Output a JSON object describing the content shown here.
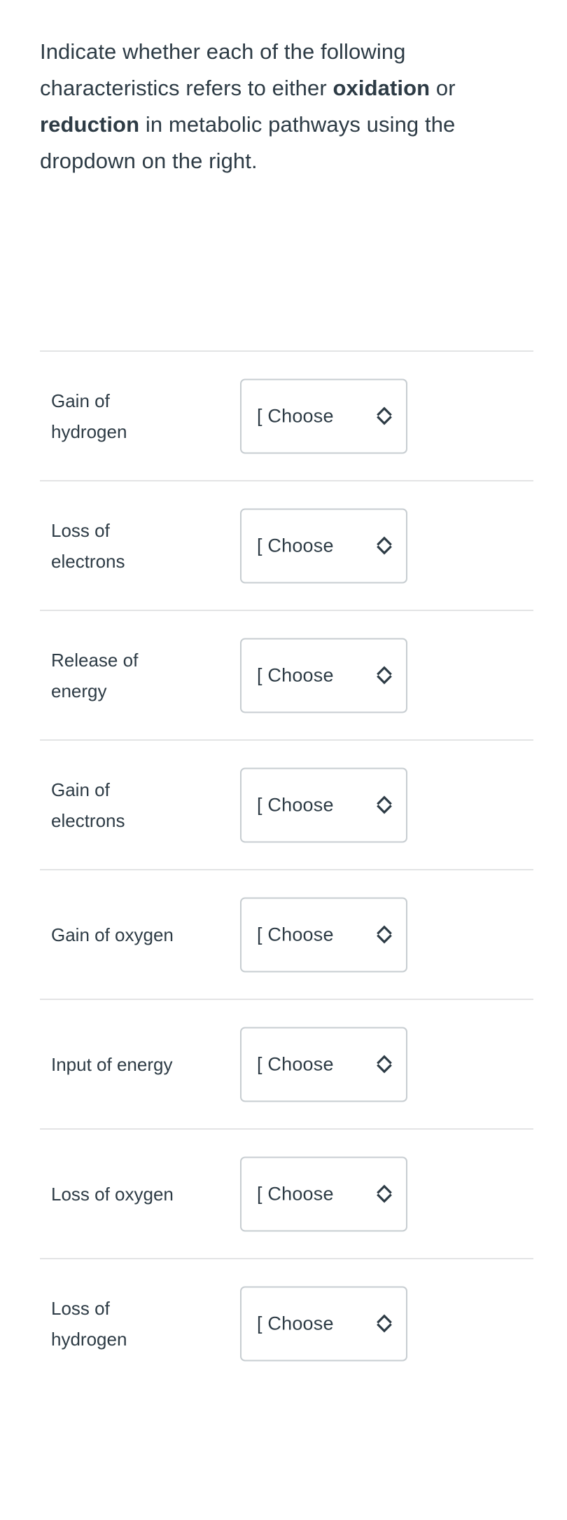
{
  "prompt": {
    "part1": "Indicate whether each of the following characteristics refers to either ",
    "bold1": "oxidation",
    "part2": " or ",
    "bold2": "reduction",
    "part3": " in metabolic pathways using the dropdown on the right."
  },
  "dropdown": {
    "placeholder_visible": "[ Choose",
    "full_label": "[ Choose ]",
    "icon": "updown-chevron-icon"
  },
  "colors": {
    "text": "#2d3b45",
    "divider": "#e3e4e5",
    "border": "#c7cdd1",
    "background": "#ffffff"
  },
  "rows": [
    {
      "label": "Gain of hydrogen",
      "value": "[ Choose"
    },
    {
      "label": "Loss of electrons",
      "value": "[ Choose"
    },
    {
      "label": "Release of energy",
      "value": "[ Choose"
    },
    {
      "label": "Gain of electrons",
      "value": "[ Choose"
    },
    {
      "label": "Gain of oxygen",
      "value": "[ Choose"
    },
    {
      "label": "Input of energy",
      "value": "[ Choose"
    },
    {
      "label": "Loss of oxygen",
      "value": "[ Choose"
    },
    {
      "label": "Loss of hydrogen",
      "value": "[ Choose"
    }
  ]
}
